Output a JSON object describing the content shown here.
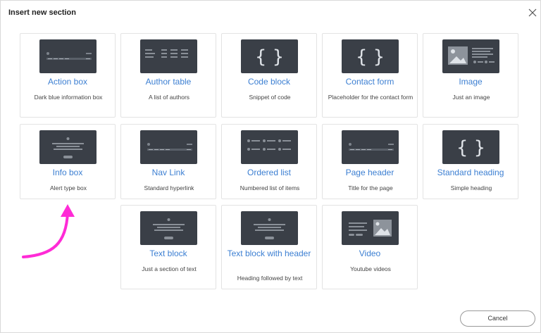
{
  "dialog": {
    "title": "Insert new section",
    "close_icon": "close-icon",
    "cancel_label": "Cancel"
  },
  "colors": {
    "thumbnail_bg": "#3a3f47",
    "card_title": "#3c7fd2",
    "arrow": "#ff2bd6"
  },
  "sections": [
    {
      "title": "Action box",
      "desc": "Dark blue information box",
      "thumb": "action-box-thumbnail"
    },
    {
      "title": "Author table",
      "desc": "A list of authors",
      "thumb": "author-table-thumbnail"
    },
    {
      "title": "Code block",
      "desc": "Snippet of code",
      "thumb": "code-braces-icon"
    },
    {
      "title": "Contact form",
      "desc": "Placeholder for the contact form",
      "thumb": "code-braces-icon"
    },
    {
      "title": "Image",
      "desc": "Just an image",
      "thumb": "image-thumbnail"
    },
    {
      "title": "Info box",
      "desc": "Alert type box",
      "thumb": "info-box-thumbnail"
    },
    {
      "title": "Nav Link",
      "desc": "Standard hyperlink",
      "thumb": "nav-link-thumbnail"
    },
    {
      "title": "Ordered list",
      "desc": "Numbered list of items",
      "thumb": "ordered-list-thumbnail"
    },
    {
      "title": "Page header",
      "desc": "Title for the page",
      "thumb": "page-header-thumbnail"
    },
    {
      "title": "Standard heading",
      "desc": "Simple heading",
      "thumb": "code-braces-icon"
    },
    {
      "title": "Text block",
      "desc": "Just a section of text",
      "thumb": "text-block-thumbnail"
    },
    {
      "title": "Text block with header",
      "desc": "Heading followed by text",
      "thumb": "text-block-thumbnail"
    },
    {
      "title": "Video",
      "desc": "Youtube videos",
      "thumb": "video-thumbnail"
    }
  ],
  "annotation": {
    "icon": "curved-arrow-icon"
  }
}
